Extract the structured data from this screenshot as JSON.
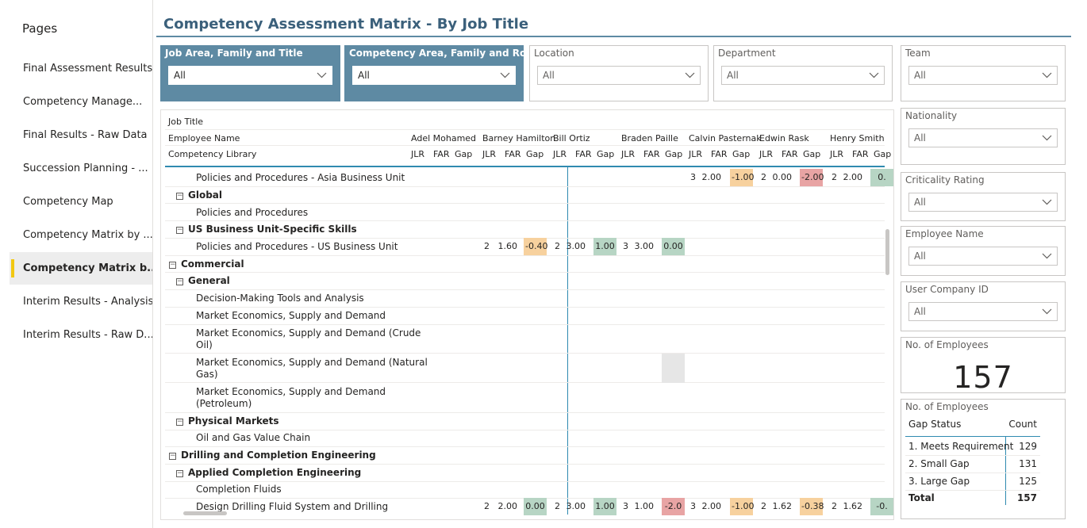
{
  "pages_panel": {
    "title": "Pages",
    "items": [
      {
        "label": "Final Assessment Results"
      },
      {
        "label": "Competency Manage..."
      },
      {
        "label": "Final Results - Raw Data"
      },
      {
        "label": "Succession Planning - ..."
      },
      {
        "label": "Competency Map"
      },
      {
        "label": "Competency Matrix by ..."
      },
      {
        "label": "Competency Matrix b...",
        "active": true
      },
      {
        "label": "Interim Results - Analysis"
      },
      {
        "label": "Interim Results - Raw D..."
      }
    ]
  },
  "report": {
    "title": "Competency Assessment Matrix - By Job Title"
  },
  "slicers": {
    "job_area": {
      "label": "Job Area, Family and Title",
      "value": "All"
    },
    "competency_area": {
      "label": "Competency Area, Family and Role",
      "value": "All"
    },
    "location": {
      "label": "Location",
      "value": "All"
    },
    "department": {
      "label": "Department",
      "value": "All"
    },
    "team": {
      "label": "Team",
      "value": "All"
    },
    "nationality": {
      "label": "Nationality",
      "value": "All"
    },
    "criticality": {
      "label": "Criticality Rating",
      "value": "All"
    },
    "employee_name": {
      "label": "Employee Name",
      "value": "All"
    },
    "user_company_id": {
      "label": "User Company ID",
      "value": "All"
    }
  },
  "employees_card": {
    "label": "No. of Employees",
    "value": "157"
  },
  "gap_table": {
    "label": "No. of Employees",
    "col_status": "Gap Status",
    "col_count": "Count",
    "rows": [
      {
        "status": "1. Meets Requirement",
        "count": "129"
      },
      {
        "status": "2. Small Gap",
        "count": "131"
      },
      {
        "status": "3. Large Gap",
        "count": "125"
      }
    ],
    "total_label": "Total",
    "total_value": "157"
  },
  "matrix": {
    "row_headers": [
      "Job Title",
      "Employee Name",
      "Competency Library"
    ],
    "employees": [
      "Adel Mohamed",
      "Barney Hamilton",
      "Bill Ortiz",
      "Braden Paille",
      "Calvin Pasternak",
      "Edwin Rask",
      "Henry Smith"
    ],
    "measure_labels": [
      "JLR",
      "FAR",
      "Gap"
    ],
    "rows": [
      {
        "label": "Policies and Procedures - Asia Business Unit"
      },
      {
        "label": "Global"
      },
      {
        "label": "Policies and Procedures"
      },
      {
        "label": "US Business Unit-Specific Skills"
      },
      {
        "label": "Policies and Procedures - US Business Unit"
      },
      {
        "label": "Commercial"
      },
      {
        "label": "General"
      },
      {
        "label": "Decision-Making Tools and Analysis"
      },
      {
        "label": "Market Economics, Supply and Demand"
      },
      {
        "label": "Market Economics, Supply and Demand (Crude"
      },
      {
        "label": "Oil)"
      },
      {
        "label": "Market Economics, Supply and Demand (Natural"
      },
      {
        "label": "Gas)"
      },
      {
        "label": "Market Economics, Supply and Demand"
      },
      {
        "label": "(Petroleum)"
      },
      {
        "label": "Physical Markets"
      },
      {
        "label": "Oil and Gas Value Chain"
      },
      {
        "label": "Drilling and Completion Engineering"
      },
      {
        "label": "Applied Completion Engineering"
      },
      {
        "label": "Completion Fluids"
      },
      {
        "label": "Design Drilling Fluid System and Drilling"
      }
    ],
    "values": {
      "asia_calvin": [
        "3",
        "2.00",
        "-1.00"
      ],
      "asia_edwin": [
        "2",
        "0.00",
        "-2.00"
      ],
      "asia_henry": [
        "2",
        "2.00",
        "0."
      ],
      "us_barney": [
        "2",
        "1.60",
        "-0.40"
      ],
      "us_bill": [
        "2",
        "3.00",
        "1.00"
      ],
      "us_braden": [
        "3",
        "3.00",
        "0.00"
      ],
      "dd_barney": [
        "2",
        "2.00",
        "0.00"
      ],
      "dd_bill": [
        "2",
        "3.00",
        "1.00"
      ],
      "dd_braden": [
        "3",
        "1.00",
        "-2.0"
      ],
      "dd_calvin": [
        "3",
        "2.00",
        "-1.00"
      ],
      "dd_edwin": [
        "2",
        "1.62",
        "-0.38"
      ],
      "dd_henry": [
        "2",
        "1.62",
        "-0."
      ]
    }
  },
  "colors": {
    "accent": "#5e8aa3",
    "title": "#3b607b",
    "gap_positive": "#b7d5c4",
    "gap_small": "#f7d19e",
    "gap_large": "#e8a4a4",
    "active_marker": "#f2c811"
  }
}
